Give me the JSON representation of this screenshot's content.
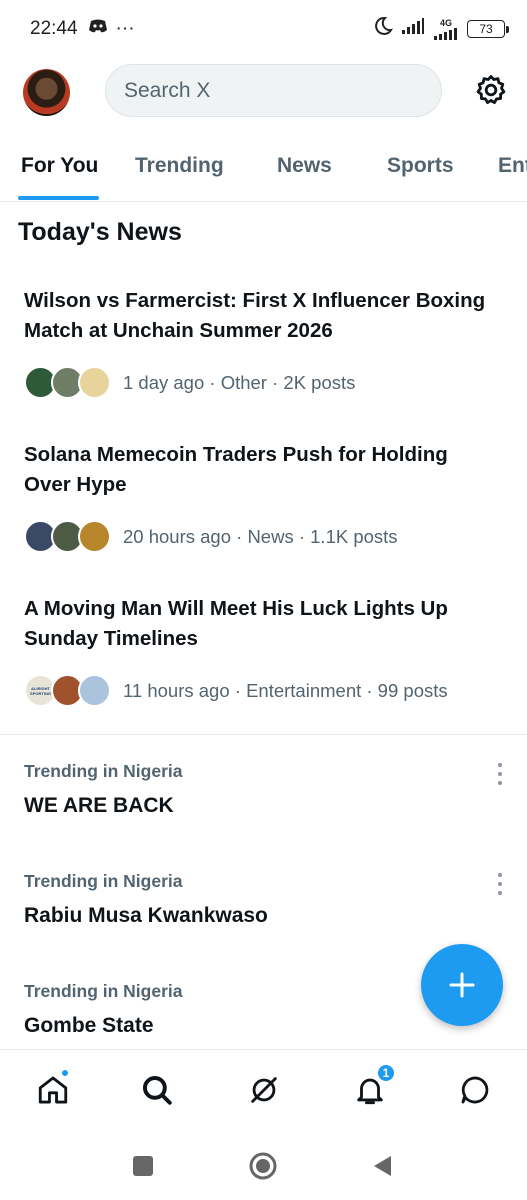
{
  "status_bar": {
    "time": "22:44",
    "ellipsis": "···",
    "network": "4G",
    "battery": "73"
  },
  "header": {
    "search_placeholder": "Search X"
  },
  "tabs": [
    {
      "label": "For You",
      "active": true
    },
    {
      "label": "Trending",
      "active": false
    },
    {
      "label": "News",
      "active": false
    },
    {
      "label": "Sports",
      "active": false
    },
    {
      "label": "Ent",
      "active": false
    }
  ],
  "section_title": "Today's News",
  "news": [
    {
      "headline": "Wilson vs Farmercist: First X Influencer Boxing Match at Unchain Summer 2026",
      "meta": "1 day ago · Other · 2K posts",
      "avatar_colors": [
        "#2f5a3a",
        "#6f7c66",
        "#e8d39a"
      ]
    },
    {
      "headline": "Solana Memecoin Traders Push for Holding Over Hype",
      "meta": "20 hours ago · News · 1.1K posts",
      "avatar_colors": [
        "#3a4a66",
        "#4d5a44",
        "#b8862a"
      ]
    },
    {
      "headline": "A Moving Man Will Meet His Luck Lights Up Sunday Timelines",
      "meta": "11 hours ago · Entertainment · 99 posts",
      "avatar_colors": [
        "#e9e4d8",
        "#a0522d",
        "#a9c4dc"
      ],
      "badge_text": "ALIRIGHT SPORTING"
    }
  ],
  "trends": [
    {
      "label": "Trending in Nigeria",
      "name": "WE ARE BACK",
      "has_more": true
    },
    {
      "label": "Trending in Nigeria",
      "name": "Rabiu Musa Kwankwaso",
      "has_more": true
    },
    {
      "label": "Trending in Nigeria",
      "name": "Gombe State",
      "has_more": false
    }
  ],
  "bottom_nav": {
    "notifications_count": "1"
  },
  "colors": {
    "accent": "#1d9bf0",
    "text_primary": "#0f1419",
    "text_secondary": "#536471"
  }
}
